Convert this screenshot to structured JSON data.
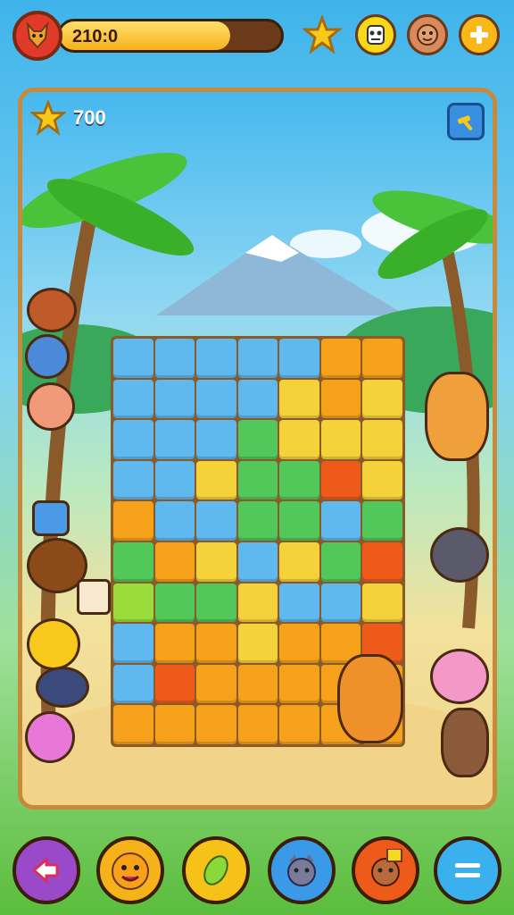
{
  "hud": {
    "level_text": "210:0",
    "level_progress": 0.77,
    "score": "700"
  },
  "colors": {
    "blue": "#5fb8ee",
    "orange": "#f5a21a",
    "yellow": "#f6d23a",
    "green": "#52c85a",
    "red": "#ee5a1a",
    "lime": "#9add3a"
  },
  "icons": {
    "player_avatar": "fox-avatar-icon",
    "star": "star-icon",
    "mask": "mask-icon",
    "friend": "bear-face-icon",
    "add": "plus-icon",
    "settings": "hammer-icon"
  },
  "board": {
    "rows": [
      [
        "blue",
        "blue",
        "blue",
        "blue",
        "blue",
        "orange",
        "orange"
      ],
      [
        "blue",
        "blue",
        "blue",
        "blue",
        "yellow",
        "orange",
        "yellow"
      ],
      [
        "blue",
        "blue",
        "blue",
        "green",
        "yellow",
        "yellow",
        "yellow"
      ],
      [
        "blue",
        "blue",
        "yellow",
        "green",
        "green",
        "red",
        "yellow"
      ],
      [
        "orange",
        "blue",
        "blue",
        "green",
        "green",
        "blue",
        "green"
      ],
      [
        "green",
        "orange",
        "yellow",
        "blue",
        "yellow",
        "green",
        "red"
      ],
      [
        "lime",
        "green",
        "green",
        "yellow",
        "blue",
        "blue",
        "yellow"
      ],
      [
        "blue",
        "orange",
        "orange",
        "yellow",
        "orange",
        "orange",
        "red"
      ],
      [
        "blue",
        "red",
        "orange",
        "orange",
        "orange",
        "orange",
        "orange"
      ],
      [
        "orange",
        "orange",
        "orange",
        "orange",
        "orange",
        "orange",
        "orange"
      ]
    ]
  },
  "bottom_buttons": [
    {
      "name": "back-button",
      "icon": "back-arrow-icon",
      "color": "#9a4ac8"
    },
    {
      "name": "tiger-button",
      "icon": "tiger-face-icon",
      "color": "#f6b21a"
    },
    {
      "name": "leaf-button",
      "icon": "leaf-icon",
      "color": "#f6c21a"
    },
    {
      "name": "cat-button",
      "icon": "cat-face-icon",
      "color": "#3a9ae8"
    },
    {
      "name": "boost-button",
      "icon": "bear-face-icon",
      "color": "#ee5a1a"
    },
    {
      "name": "menu-button",
      "icon": "menu-icon",
      "color": "#3ab0ee"
    }
  ]
}
